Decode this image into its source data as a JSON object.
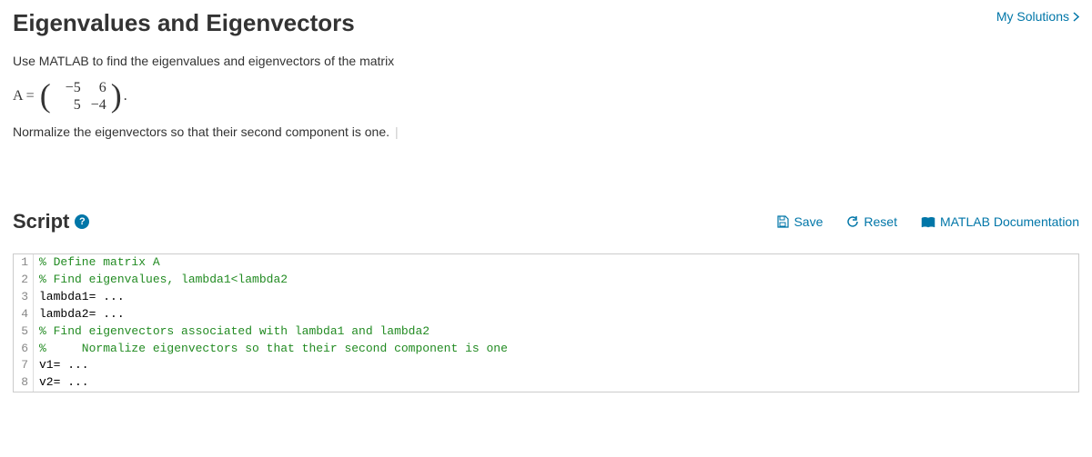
{
  "header": {
    "title": "Eigenvalues and Eigenvectors",
    "my_solutions": "My Solutions"
  },
  "problem": {
    "intro": "Use MATLAB to find the eigenvalues and eigenvectors of the matrix",
    "a_label": "A =",
    "matrix_r1c1": "−5",
    "matrix_r1c2": "6",
    "matrix_r2c1": "5",
    "matrix_r2c2": "−4",
    "after_matrix": ".",
    "normalize": "Normalize the eigenvectors so that their second component is one."
  },
  "script": {
    "label": "Script",
    "help": "?",
    "save": "Save",
    "reset": "Reset",
    "doc": "MATLAB Documentation"
  },
  "code": {
    "lines": [
      {
        "n": "1",
        "cls": "comment",
        "text": "% Define matrix A"
      },
      {
        "n": "2",
        "cls": "comment",
        "text": "% Find eigenvalues, lambda1<lambda2"
      },
      {
        "n": "3",
        "cls": "",
        "text": "lambda1= ..."
      },
      {
        "n": "4",
        "cls": "",
        "text": "lambda2= ..."
      },
      {
        "n": "5",
        "cls": "comment",
        "text": "% Find eigenvectors associated with lambda1 and lambda2"
      },
      {
        "n": "6",
        "cls": "comment",
        "text": "%     Normalize eigenvectors so that their second component is one"
      },
      {
        "n": "7",
        "cls": "",
        "text": "v1= ..."
      },
      {
        "n": "8",
        "cls": "",
        "text": "v2= ..."
      }
    ]
  }
}
